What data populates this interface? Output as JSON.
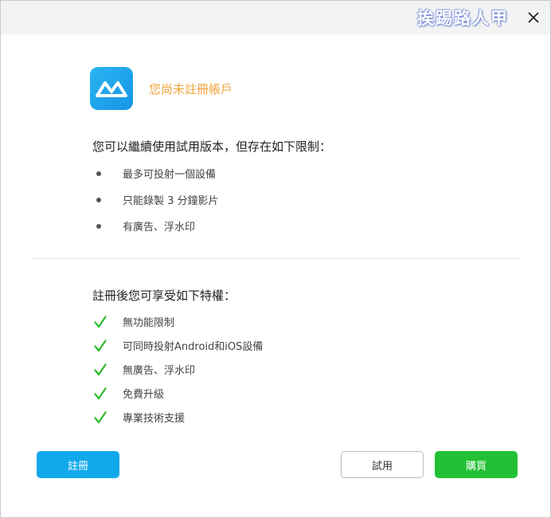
{
  "window": {
    "watermark": "挨踢路人甲",
    "close_icon": "close-icon"
  },
  "header": {
    "logo_icon": "apowermirror-logo",
    "title": "您尚未註冊帳戶"
  },
  "limits": {
    "title": "您可以繼續使用試用版本，但存在如下限制：",
    "items": [
      "最多可投射一個設備",
      "只能錄製 3 分鐘影片",
      "有廣告、浮水印"
    ]
  },
  "benefits": {
    "title": "註冊後您可享受如下特權：",
    "items": [
      "無功能限制",
      "可同時投射Android和iOS設備",
      "無廣告、浮水印",
      "免費升級",
      "專業技術支援"
    ]
  },
  "buttons": {
    "register": "註冊",
    "trial": "試用",
    "buy": "購買"
  },
  "colors": {
    "accent_blue": "#12a9eb",
    "buy_green": "#22c135",
    "title_orange": "#f0a23a",
    "check_green": "#2dbb2d"
  }
}
